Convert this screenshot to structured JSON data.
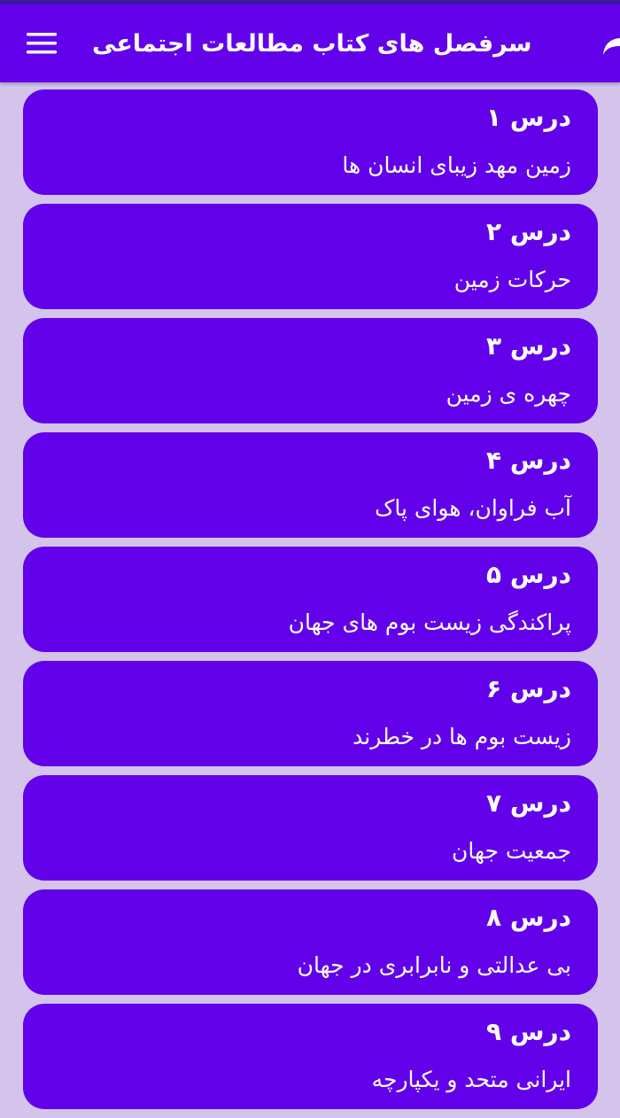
{
  "colors": {
    "primary": "#6200ea",
    "background": "#d4c4ec",
    "status_bar": "#3a18a0",
    "text": "#ffffff"
  },
  "appbar": {
    "title": "سرفصل های کتاب مطالعات اجتماعی",
    "menu_icon": "menu-icon",
    "share_icon": "share-icon"
  },
  "lessons": [
    {
      "title": "درس ۱",
      "subtitle": "زمین مهد زیبای انسان ها"
    },
    {
      "title": "درس ۲",
      "subtitle": "حرکات زمین"
    },
    {
      "title": "درس ۳",
      "subtitle": "چهره ی زمین"
    },
    {
      "title": "درس ۴",
      "subtitle": "آب فراوان، هوای پاک"
    },
    {
      "title": "درس ۵",
      "subtitle": "پراکندگی زیست بوم های جهان"
    },
    {
      "title": "درس ۶",
      "subtitle": "زیست بوم ها در خطرند"
    },
    {
      "title": "درس ۷",
      "subtitle": "جمعیت جهان"
    },
    {
      "title": "درس ۸",
      "subtitle": "بی عدالتی و نابرابری در جهان"
    },
    {
      "title": "درس ۹",
      "subtitle": "ایرانی متحد و یکپارچه"
    }
  ]
}
